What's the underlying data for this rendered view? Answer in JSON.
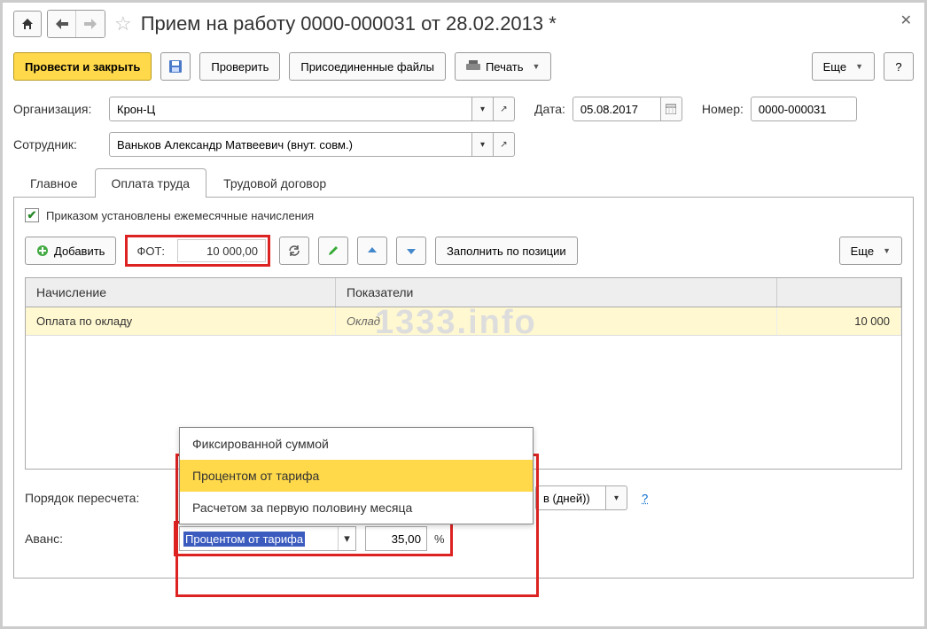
{
  "title": "Прием на работу 0000-000031 от 28.02.2013 *",
  "toolbar": {
    "submit_close": "Провести и закрыть",
    "check": "Проверить",
    "attached": "Присоединенные файлы",
    "print": "Печать",
    "more": "Еще",
    "help": "?"
  },
  "fields": {
    "org_label": "Организация:",
    "org_value": "Крон-Ц",
    "date_label": "Дата:",
    "date_value": "05.08.2017",
    "number_label": "Номер:",
    "number_value": "0000-000031",
    "employee_label": "Сотрудник:",
    "employee_value": "Ваньков Александр Матвеевич (внут. совм.)"
  },
  "tabs": {
    "main": "Главное",
    "pay": "Оплата труда",
    "contract": "Трудовой договор"
  },
  "pay_tab": {
    "checkbox_label": "Приказом установлены ежемесячные начисления",
    "add": "Добавить",
    "fot_label": "ФОТ:",
    "fot_value": "10 000,00",
    "fill_by_position": "Заполнить по позиции",
    "more": "Еще",
    "grid": {
      "col_accrual": "Начисление",
      "col_indicators": "Показатели",
      "row": {
        "accrual": "Оплата по окладу",
        "indicator": "Оклад",
        "value": "10 000"
      }
    },
    "recalc_label": "Порядок пересчета:",
    "recalc_value_suffix": "в (дней))",
    "advance_label": "Аванс:",
    "advance_value": "Процентом от тарифа",
    "advance_pct": "35,00",
    "pct_symbol": "%",
    "dropdown": {
      "opt1": "Фиксированной суммой",
      "opt2": "Процентом от тарифа",
      "opt3": "Расчетом за первую половину месяца"
    }
  },
  "watermark": "1333.info"
}
